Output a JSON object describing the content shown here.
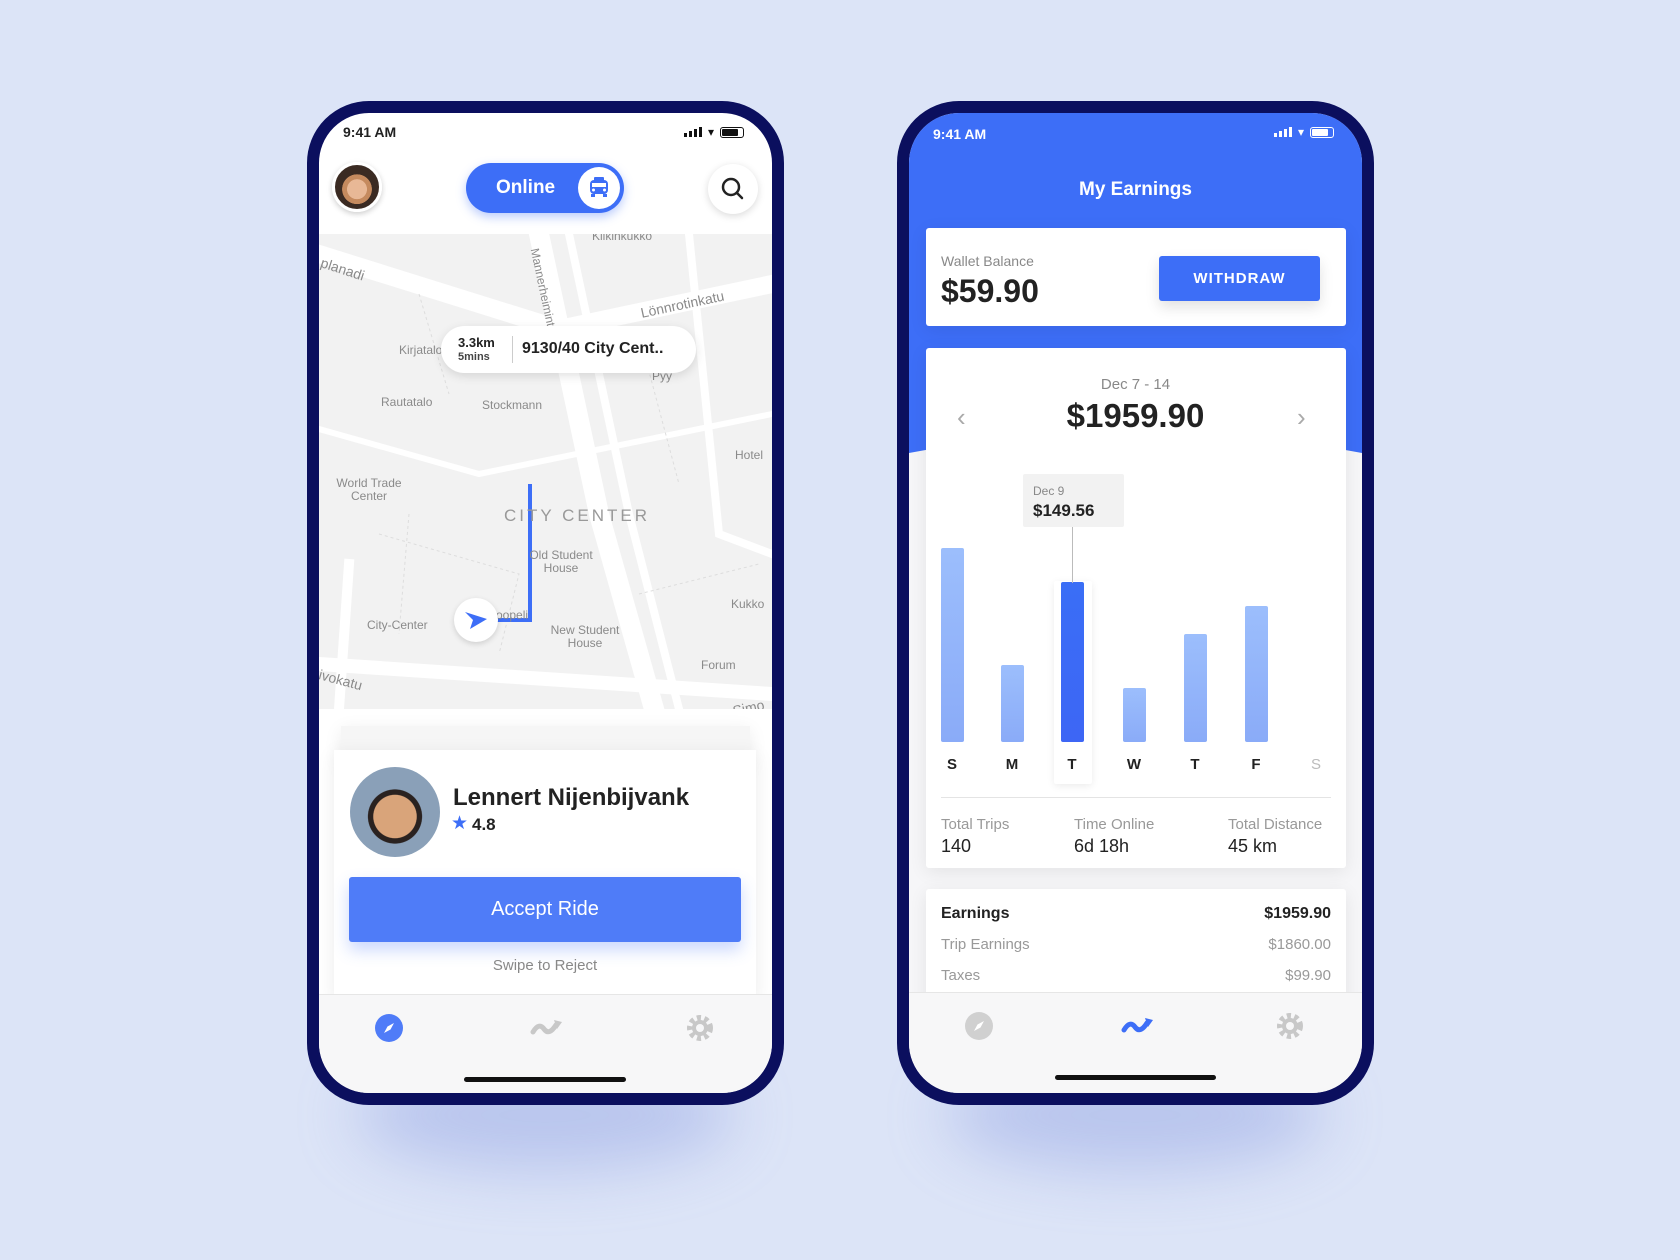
{
  "colors": {
    "background": "#dce4f7",
    "frame": "#0b0f5e",
    "accent": "#3d6ef7",
    "button": "#4f7cf8",
    "bar": "#93b6fb",
    "bar_active": "#3a6ef6"
  },
  "left": {
    "status": {
      "time": "9:41 AM"
    },
    "online_toggle": {
      "label": "Online",
      "icon": "taxi-icon"
    },
    "map": {
      "labels": [
        "Kiikinkukko",
        "planadi",
        "Mannerheimintie",
        "Lönnrotinkatu",
        "Kirjatalo",
        "Pyy",
        "Rautatalo",
        "Stockmann",
        "Hotel",
        "World Trade Center",
        "CITY CENTER",
        "Old Student House",
        "Kukko",
        "Soopeli",
        "City-Center",
        "New Student House",
        "Forum",
        "ivokatu",
        "Simo"
      ]
    },
    "callout": {
      "distance": "3.3km",
      "time": "5mins",
      "address": "9130/40 City Cent.."
    },
    "ride": {
      "name": "Lennert Nijenbijvank",
      "rating": "4.8",
      "accept": "Accept Ride",
      "reject": "Swipe to Reject"
    },
    "tabs": [
      "compass-icon",
      "trend-icon",
      "gear-icon"
    ]
  },
  "right": {
    "status": {
      "time": "9:41 AM"
    },
    "title": "My Earnings",
    "wallet": {
      "label": "Wallet Balance",
      "amount": "$59.90",
      "button": "WITHDRAW"
    },
    "period": {
      "range": "Dec 7 - 14",
      "total": "$1959.90"
    },
    "tooltip": {
      "date": "Dec 9",
      "amount": "$149.56"
    },
    "stats": [
      {
        "label": "Total Trips",
        "value": "140"
      },
      {
        "label": "Time Online",
        "value": "6d 18h"
      },
      {
        "label": "Total Distance",
        "value": "45 km"
      }
    ],
    "earnings": [
      {
        "label": "Earnings",
        "value": "$1959.90"
      },
      {
        "label": "Trip Earnings",
        "value": "$1860.00"
      },
      {
        "label": "Taxes",
        "value": "$99.90"
      }
    ],
    "tabs": [
      "compass-icon",
      "trend-icon",
      "gear-icon"
    ]
  },
  "chart_data": {
    "type": "bar",
    "categories": [
      "S",
      "M",
      "T",
      "W",
      "T",
      "F",
      "S"
    ],
    "values": [
      181,
      72,
      149.56,
      50,
      101,
      127,
      0
    ],
    "selected_index": 2,
    "grid": false,
    "title": "",
    "xlabel": "",
    "ylabel": ""
  }
}
